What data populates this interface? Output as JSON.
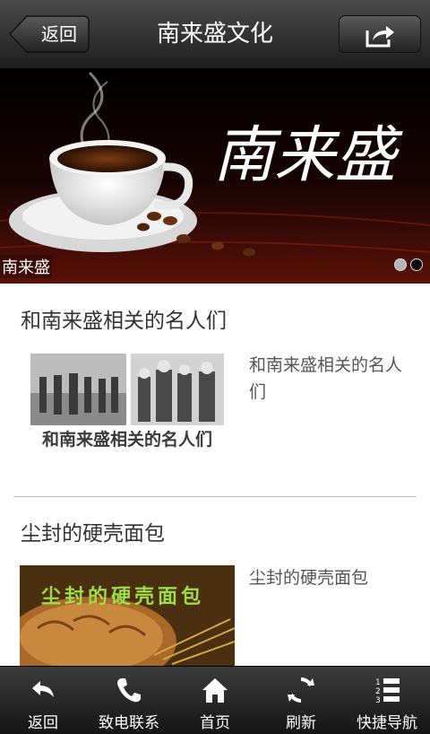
{
  "header": {
    "back_label": "返回",
    "title": "南来盛文化",
    "share_icon": "share-icon"
  },
  "banner": {
    "calligraphy": "南来盛",
    "caption": "南来盛",
    "active_slide": 1,
    "slide_count": 2
  },
  "articles": [
    {
      "title": "和南来盛相关的名人们",
      "thumb_caption": "和南来盛相关的名人们",
      "description": "和南来盛相关的名人们"
    },
    {
      "title": "尘封的硬壳面包",
      "thumb_caption": "尘封的硬壳面包",
      "description": "尘封的硬壳面包"
    }
  ],
  "tabbar": {
    "items": [
      {
        "label": "返回",
        "icon": "back-arrow-icon"
      },
      {
        "label": "致电联系",
        "icon": "phone-icon"
      },
      {
        "label": "首页",
        "icon": "home-icon"
      },
      {
        "label": "刷新",
        "icon": "refresh-icon"
      },
      {
        "label": "快捷导航",
        "icon": "numbered-list-icon"
      }
    ]
  },
  "colors": {
    "header_bg": "#2b2b2b",
    "tabbar_bg": "#222222",
    "text_dark": "#333333",
    "text_gray": "#555555",
    "divider": "#bdbdbd"
  }
}
